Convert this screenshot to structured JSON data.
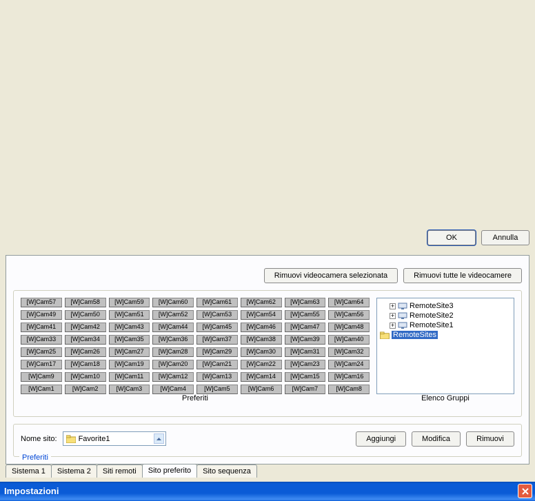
{
  "window": {
    "title": "Impostazioni"
  },
  "tabs": {
    "items": [
      {
        "label": "Sistema 1"
      },
      {
        "label": "Sistema 2"
      },
      {
        "label": "Siti remoti"
      },
      {
        "label": "Sito preferito"
      },
      {
        "label": "Sito sequenza"
      }
    ],
    "active_index": 3
  },
  "favorites": {
    "legend": "Preferiti",
    "site_label": "Nome sito:",
    "combo_value": "Favorite1",
    "combo_icon": "favorite-icon",
    "add_label": "Aggiungi",
    "modify_label": "Modifica",
    "remove_label": "Rimuovi"
  },
  "panels": {
    "left_header": "Preferiti",
    "right_header": "Elenco Gruppi"
  },
  "cams": [
    "[W]Cam1",
    "[W]Cam2",
    "[W]Cam3",
    "[W]Cam4",
    "[W]Cam5",
    "[W]Cam6",
    "[W]Cam7",
    "[W]Cam8",
    "[W]Cam9",
    "[W]Cam10",
    "[W]Cam11",
    "[W]Cam12",
    "[W]Cam13",
    "[W]Cam14",
    "[W]Cam15",
    "[W]Cam16",
    "[W]Cam17",
    "[W]Cam18",
    "[W]Cam19",
    "[W]Cam20",
    "[W]Cam21",
    "[W]Cam22",
    "[W]Cam23",
    "[W]Cam24",
    "[W]Cam25",
    "[W]Cam26",
    "[W]Cam27",
    "[W]Cam28",
    "[W]Cam29",
    "[W]Cam30",
    "[W]Cam31",
    "[W]Cam32",
    "[W]Cam33",
    "[W]Cam34",
    "[W]Cam35",
    "[W]Cam36",
    "[W]Cam37",
    "[W]Cam38",
    "[W]Cam39",
    "[W]Cam40",
    "[W]Cam41",
    "[W]Cam42",
    "[W]Cam43",
    "[W]Cam44",
    "[W]Cam45",
    "[W]Cam46",
    "[W]Cam47",
    "[W]Cam48",
    "[W]Cam49",
    "[W]Cam50",
    "[W]Cam51",
    "[W]Cam52",
    "[W]Cam53",
    "[W]Cam54",
    "[W]Cam55",
    "[W]Cam56",
    "[W]Cam57",
    "[W]Cam58",
    "[W]Cam59",
    "[W]Cam60",
    "[W]Cam61",
    "[W]Cam62",
    "[W]Cam63",
    "[W]Cam64"
  ],
  "tree": {
    "root": "RemoteSites",
    "children": [
      {
        "label": "RemoteSite1"
      },
      {
        "label": "RemoteSite2"
      },
      {
        "label": "RemoteSite3"
      }
    ]
  },
  "remove_buttons": {
    "selected": "Rimuovi videocamera selezionata",
    "all": "Rimuovi tutte le videocamere"
  },
  "footer": {
    "ok": "OK",
    "cancel": "Annulla"
  }
}
